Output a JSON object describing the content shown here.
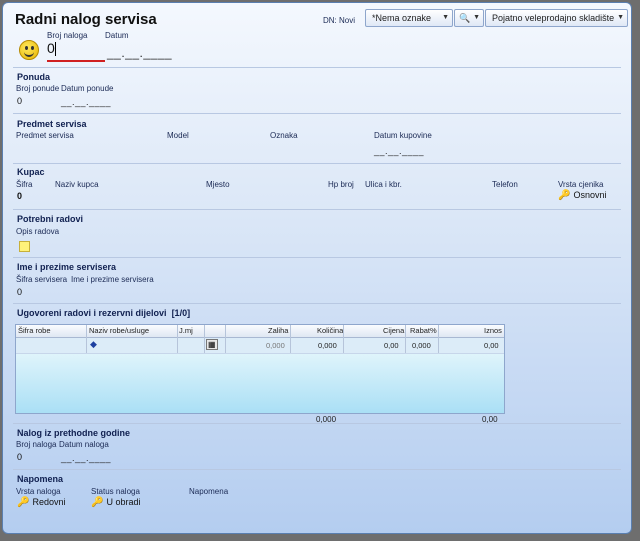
{
  "header": {
    "title": "Radni nalog servisa",
    "dn_label": "DN: Novi",
    "oznake_combo": "*Nema oznake",
    "skladiste_combo": "Pojatno veleprodajno skladište"
  },
  "order": {
    "broj_label": "Broj naloga",
    "broj_value": "0",
    "datum_label": "Datum",
    "datum_value": "__.__.____"
  },
  "ponuda": {
    "title": "Ponuda",
    "broj_label": "Broj ponude",
    "broj_value": "0",
    "datum_label": "Datum ponude",
    "datum_value": "__.__.____"
  },
  "predmet": {
    "title": "Predmet servisa",
    "col1": "Predmet servisa",
    "col2": "Model",
    "col3": "Oznaka",
    "col4": "Datum kupovine",
    "datum_value": "__.__.____"
  },
  "kupac": {
    "title": "Kupac",
    "sifra": "Šifra",
    "naziv": "Naziv kupca",
    "mjesto": "Mjesto",
    "hp": "Hp broj",
    "ulica": "Ulica i kbr.",
    "telefon": "Telefon",
    "vrsta": "Vrsta cjenika",
    "sifra_value": "0",
    "vrsta_value": "Osnovni"
  },
  "radovi": {
    "title": "Potrebni radovi",
    "opis_label": "Opis radova"
  },
  "serviser": {
    "title": "Ime i prezime servisera",
    "sifra_label": "Šifra servisera",
    "ime_label": "Ime i prezime servisera",
    "sifra_value": "0"
  },
  "ugovoreni": {
    "title": "Ugovoreni radovi i rezervni dijelovi",
    "count": "[1/0]",
    "columns": [
      "Šifra robe",
      "Naziv robe/usluge",
      "J.mj",
      "",
      "Zaliha",
      "Količina",
      "Cijena",
      "Rabat%",
      "Iznos"
    ],
    "row": {
      "zaliha": "0,000",
      "kolicina": "0,000",
      "cijena": "0,00",
      "rabat": "0,000",
      "iznos": "0,00"
    },
    "totals": {
      "kolicina": "0,000",
      "iznos": "0,00"
    }
  },
  "prethodni": {
    "title": "Nalog iz prethodne godine",
    "broj_label": "Broj naloga",
    "datum_label": "Datum naloga",
    "broj_value": "0",
    "datum_value": "__.__.____"
  },
  "napomena": {
    "title": "Napomena",
    "vrsta_label": "Vrsta naloga",
    "status_label": "Status naloga",
    "napomena_label": "Napomena",
    "vrsta_value": "Redovni",
    "status_value": "U obradi"
  }
}
